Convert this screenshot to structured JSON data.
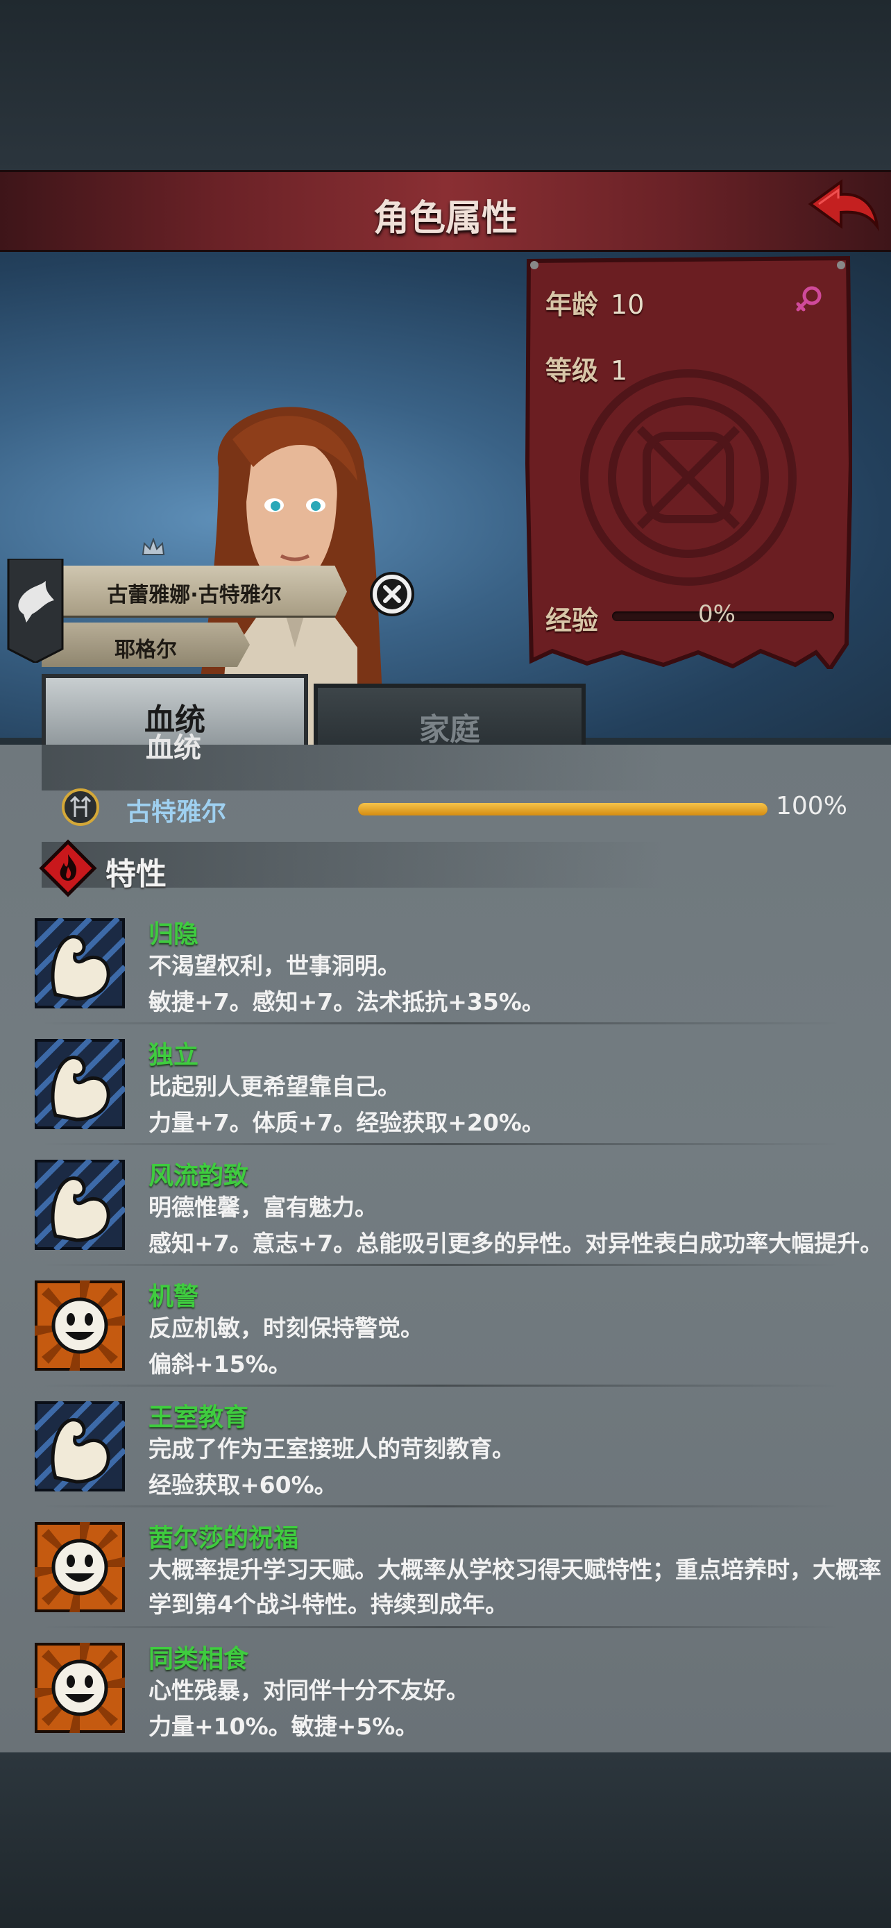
{
  "header": {
    "title": "角色属性"
  },
  "character": {
    "full_name": "古蕾雅娜·古特雅尔",
    "title": "耶格尔"
  },
  "stats": {
    "age_label": "年龄",
    "age_value": "10",
    "level_label": "等级",
    "level_value": "1",
    "exp_label": "经验",
    "exp_value": "0%",
    "exp_fraction": 0
  },
  "tabs": [
    {
      "label": "血统",
      "active": true
    },
    {
      "label": "家庭",
      "active": false
    }
  ],
  "lineage": {
    "section_label": "血统",
    "entry_name": "古特雅尔",
    "entry_pct": "100%",
    "entry_fraction": 1.0
  },
  "traits_heading": "特性",
  "traits": [
    {
      "name": "归隐",
      "desc": "不渴望权利，世事洞明。",
      "effect": "敏捷+7。感知+7。法术抵抗+35%。",
      "icon": "muscle-arm-icon"
    },
    {
      "name": "独立",
      "desc": "比起别人更希望靠自己。",
      "effect": "力量+7。体质+7。经验获取+20%。",
      "icon": "muscle-arm-icon"
    },
    {
      "name": "风流韵致",
      "desc": "明德惟馨，富有魅力。",
      "effect": "感知+7。意志+7。总能吸引更多的异性。对异性表白成功率大幅提升。",
      "icon": "muscle-arm-icon"
    },
    {
      "name": "机警",
      "desc": "反应机敏，时刻保持警觉。",
      "effect": "偏斜+15%。",
      "icon": "smiley-face-icon"
    },
    {
      "name": "王室教育",
      "desc": "完成了作为王室接班人的苛刻教育。",
      "effect": "经验获取+60%。",
      "icon": "muscle-arm-icon"
    },
    {
      "name": "茜尔莎的祝福",
      "desc": "大概率提升学习天赋。大概率从学校习得天赋特性；重点培养时，大概率学到第4个战斗特性。持续到成年。",
      "effect": "",
      "icon": "smiley-face-icon"
    },
    {
      "name": "同类相食",
      "desc": "心性残暴，对同伴十分不友好。",
      "effect": "力量+10%。敏捷+5%。",
      "icon": "smiley-face-icon"
    }
  ],
  "colors": {
    "header_red": "#8a2f33",
    "trait_name_green": "#3fcc3f",
    "lineage_name_blue": "#9fd0f0",
    "lineage_bar_gold": "#f5c24a",
    "female_symbol": "#d04a9a"
  }
}
